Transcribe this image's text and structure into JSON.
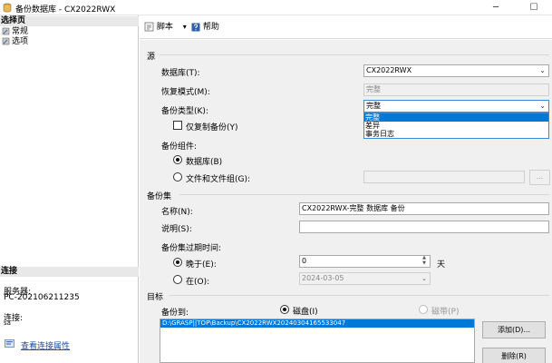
{
  "window": {
    "title": "备份数据库 - CX2022RWX",
    "minimize": "─",
    "maximize": "☐"
  },
  "left": {
    "select_page_header": "选择页",
    "pages": [
      "常规",
      "选项"
    ],
    "connect_header": "连接",
    "server_label": "服务器:",
    "server_value": "PC-202106211235",
    "connection_label": "连接:",
    "connection_value": "sa",
    "view_conn_props": "查看连接属性"
  },
  "toolbar": {
    "script_label": "脚本",
    "help_label": "帮助",
    "dropdown_caret": "▾"
  },
  "source": {
    "section_title": "源",
    "database_label": "数据库(T):",
    "database_value": "CX2022RWX",
    "recovery_label": "恢复模式(M):",
    "recovery_value": "完整",
    "backup_type_label": "备份类型(K):",
    "backup_type_value": "完整",
    "backup_type_options": [
      "完整",
      "差异",
      "事务日志"
    ],
    "copy_only_label": "仅复制备份(Y)",
    "component_label": "备份组件:",
    "component_database": "数据库(B)",
    "component_files": "文件和文件组(G):",
    "files_browse": "..."
  },
  "backup_set": {
    "section_title": "备份集",
    "name_label": "名称(N):",
    "name_value": "CX2022RWX-完整 数据库 备份",
    "desc_label": "说明(S):",
    "desc_value": "",
    "expire_label": "备份集过期时间:",
    "after_label": "晚于(E):",
    "after_value": "0",
    "after_unit": "天",
    "on_label": "在(O):",
    "on_value": "2024-03-05"
  },
  "destination": {
    "section_title": "目标",
    "backup_to_label": "备份到:",
    "disk_label": "磁盘(I)",
    "tape_label": "磁带(P)",
    "paths": [
      "D:\\GRASP||TOP\\Backup\\CX2022RWX20240304165533047"
    ],
    "add_button": "添加(D)...",
    "remove_button": "删除(R)"
  }
}
